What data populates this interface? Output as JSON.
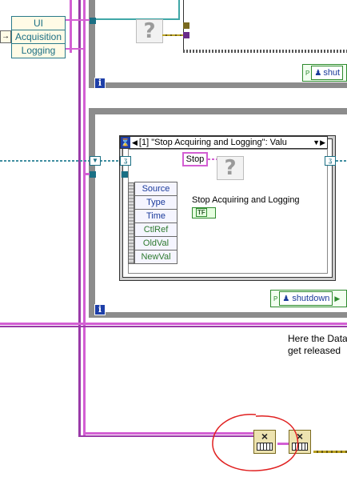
{
  "cluster_items": [
    "UI",
    "Acquisition",
    "Logging"
  ],
  "event_selector_label": "[1] \"Stop Acquiring and Logging\": Valu",
  "stop_terminal_label": "Stop",
  "event_name_label": "Stop Acquiring and Logging",
  "bool_constant_label": "TF",
  "event_data_nodes": [
    "Source",
    "Type",
    "Time",
    "CtlRef",
    "OldVal",
    "NewVal"
  ],
  "shutdown_top_label": "shut",
  "shutdown_bottom_label": "shutdown",
  "iteration_label": "i",
  "comment_line1": "Here the Data",
  "comment_line2": "get released",
  "question_glyph": "?",
  "release_glyph": "×",
  "colors": {
    "error_wire": "#d35fd3",
    "queue_wire": "#9a3aa8",
    "frame_border": "#8c8c8c",
    "annotation_circle": "#e02020"
  }
}
